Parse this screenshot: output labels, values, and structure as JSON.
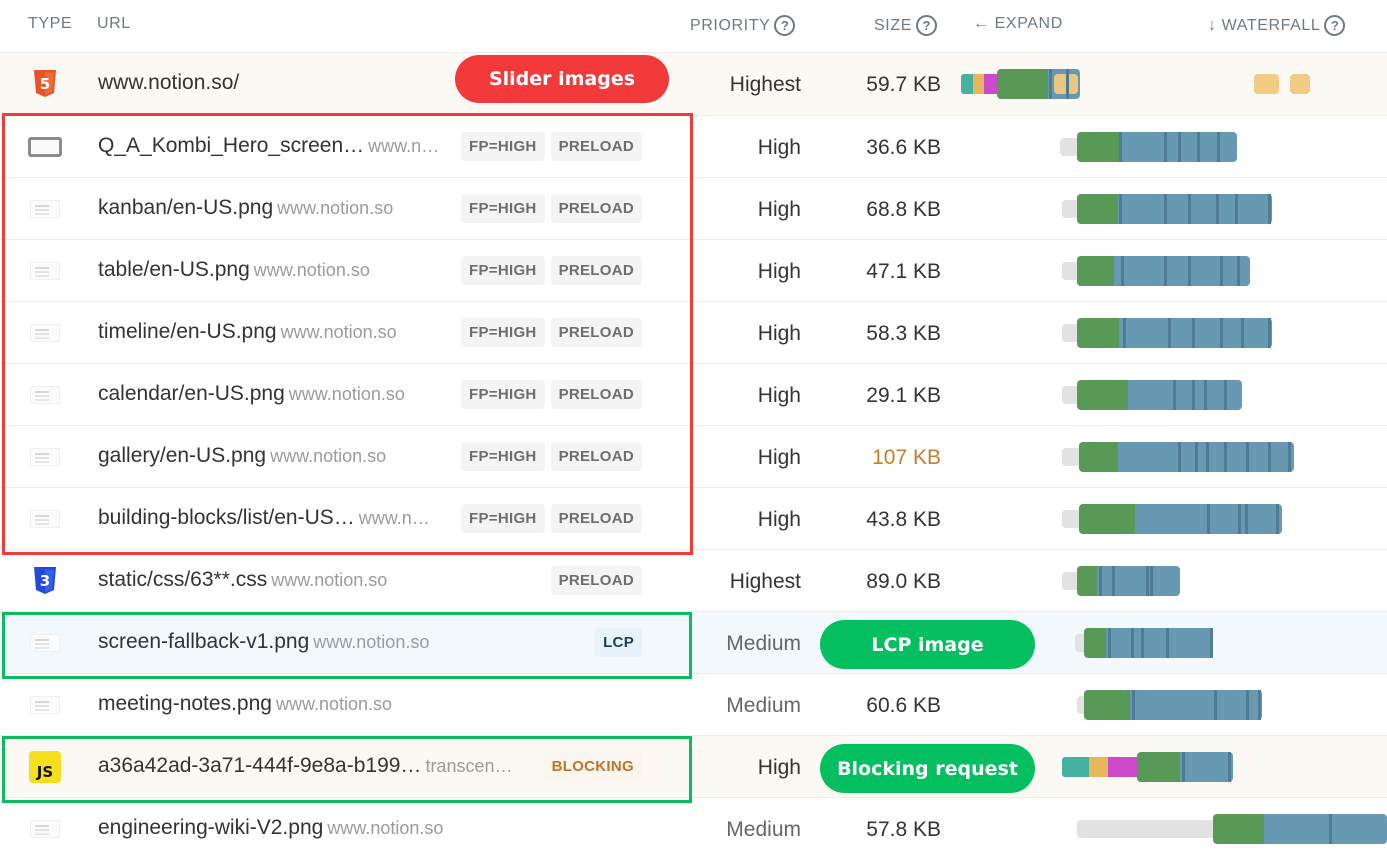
{
  "header": {
    "type": "TYPE",
    "url": "URL",
    "priority": "PRIORITY",
    "size": "SIZE",
    "expand": "← EXPAND",
    "waterfall": "↓ WATERFALL",
    "help_glyph": "?"
  },
  "rows": [
    {
      "type_icon": "html5-icon",
      "type_label": "5",
      "name": "www.notion.so/",
      "host": "",
      "tags": [],
      "priority": "Highest",
      "size": "59.7 KB",
      "size_warning": false
    },
    {
      "type_icon": "image-thumbnail-icon",
      "name": "Q_A_Kombi_Hero_screen…",
      "host": "www.n…",
      "tags": [
        "FP=HIGH",
        "PRELOAD"
      ],
      "priority": "High",
      "size": "36.6 KB",
      "size_warning": false
    },
    {
      "type_icon": "image-thumbnail-icon",
      "name": "kanban/en-US.png",
      "host": "www.notion.so",
      "tags": [
        "FP=HIGH",
        "PRELOAD"
      ],
      "priority": "High",
      "size": "68.8 KB",
      "size_warning": false
    },
    {
      "type_icon": "image-thumbnail-icon",
      "name": "table/en-US.png",
      "host": "www.notion.so",
      "tags": [
        "FP=HIGH",
        "PRELOAD"
      ],
      "priority": "High",
      "size": "47.1 KB",
      "size_warning": false
    },
    {
      "type_icon": "image-thumbnail-icon",
      "name": "timeline/en-US.png",
      "host": "www.notion.so",
      "tags": [
        "FP=HIGH",
        "PRELOAD"
      ],
      "priority": "High",
      "size": "58.3 KB",
      "size_warning": false
    },
    {
      "type_icon": "image-thumbnail-icon",
      "name": "calendar/en-US.png",
      "host": "www.notion.so",
      "tags": [
        "FP=HIGH",
        "PRELOAD"
      ],
      "priority": "High",
      "size": "29.1 KB",
      "size_warning": false
    },
    {
      "type_icon": "image-thumbnail-icon",
      "name": "gallery/en-US.png",
      "host": "www.notion.so",
      "tags": [
        "FP=HIGH",
        "PRELOAD"
      ],
      "priority": "High",
      "size": "107 KB",
      "size_warning": true
    },
    {
      "type_icon": "image-thumbnail-icon",
      "name": "building-blocks/list/en-US…",
      "host": "www.n…",
      "tags": [
        "FP=HIGH",
        "PRELOAD"
      ],
      "priority": "High",
      "size": "43.8 KB",
      "size_warning": false
    },
    {
      "type_icon": "css3-icon",
      "type_label": "3",
      "name": "static/css/63**.css",
      "host": "www.notion.so",
      "tags": [
        "PRELOAD"
      ],
      "priority": "Highest",
      "size": "89.0 KB",
      "size_warning": false
    },
    {
      "type_icon": "image-thumbnail-icon",
      "name": "screen-fallback-v1.png",
      "host": "www.notion.so",
      "tags": [
        "LCP"
      ],
      "priority": "Medium",
      "size": "",
      "size_warning": false
    },
    {
      "type_icon": "image-thumbnail-icon",
      "name": "meeting-notes.png",
      "host": "www.notion.so",
      "tags": [],
      "priority": "Medium",
      "size": "60.6 KB",
      "size_warning": false
    },
    {
      "type_icon": "javascript-icon",
      "type_label": "JS",
      "name": "a36a42ad-3a71-444f-9e8a-b199…",
      "host": "transcen…",
      "tags": [
        "BLOCKING"
      ],
      "priority": "High",
      "size": "",
      "size_warning": false
    },
    {
      "type_icon": "image-thumbnail-icon",
      "name": "engineering-wiki-V2.png",
      "host": "www.notion.so",
      "tags": [],
      "priority": "Medium",
      "size": "57.8 KB",
      "size_warning": false
    }
  ],
  "annotations": {
    "slider": "Slider images",
    "lcp": "LCP image",
    "blocking": "Blocking request"
  },
  "colors": {
    "slider_outline": "#f23a3a",
    "highlight_outline": "#0dbb5f",
    "waiting": "#e2e2e2",
    "dns": "#45b1a3",
    "connect": "#e8b75a",
    "ssl": "#cd4bca",
    "ttfb": "#589957",
    "download": "#6899b3",
    "size_warning": "#c1802e"
  }
}
